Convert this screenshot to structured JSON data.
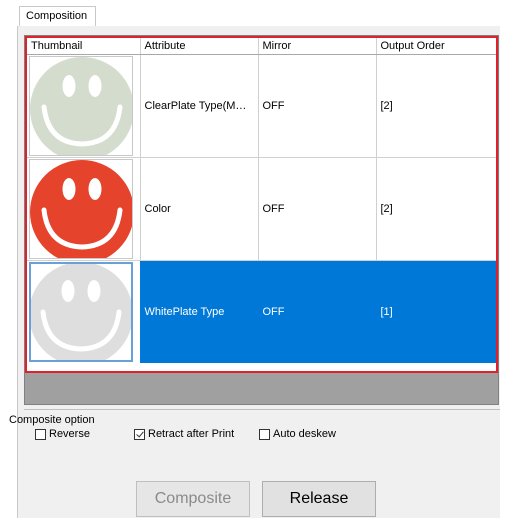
{
  "tab": {
    "label": "Composition"
  },
  "grid": {
    "columns": [
      "Thumbnail",
      "Attribute",
      "Mirror",
      "Output Order"
    ],
    "rows": [
      {
        "attribute": "ClearPlate Type(M…",
        "mirror": "OFF",
        "output_order": "[2]",
        "thumb_color": "#d3dccd",
        "selected": false
      },
      {
        "attribute": "Color",
        "mirror": "OFF",
        "output_order": "[2]",
        "thumb_color": "#e5432b",
        "selected": false
      },
      {
        "attribute": "WhitePlate Type",
        "mirror": "OFF",
        "output_order": "[1]",
        "thumb_color": "#dedede",
        "selected": true
      }
    ]
  },
  "composite_option": {
    "title": "Composite option",
    "reverse": {
      "label": "Reverse",
      "checked": false
    },
    "retract_after_print": {
      "label": "Retract after Print",
      "checked": true
    },
    "auto_deskew": {
      "label": "Auto deskew",
      "checked": false
    }
  },
  "buttons": {
    "composite": {
      "label": "Composite",
      "enabled": false
    },
    "release": {
      "label": "Release",
      "enabled": true
    }
  },
  "colors": {
    "selection": "#0078d7",
    "highlight_border": "#e0202a"
  }
}
